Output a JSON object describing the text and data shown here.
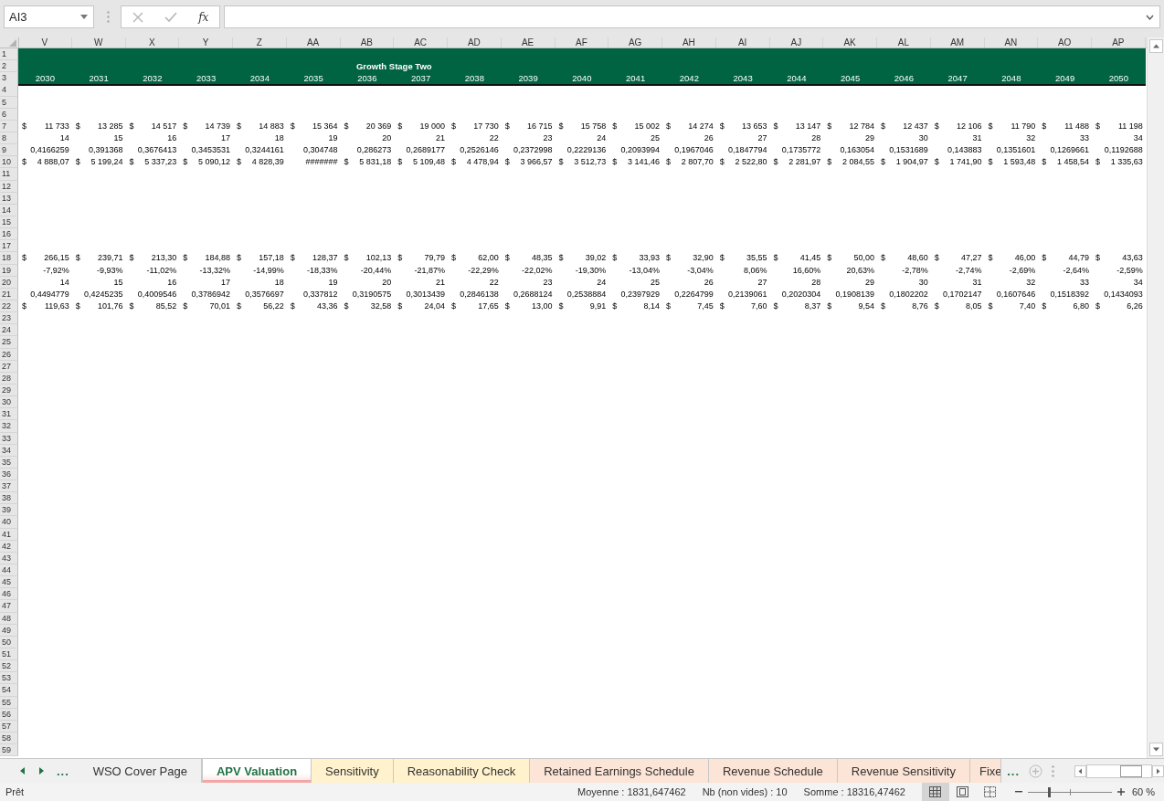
{
  "formula_bar": {
    "name_box": "AI3",
    "function_button": "fx"
  },
  "columns": [
    "V",
    "W",
    "X",
    "Y",
    "Z",
    "AA",
    "AB",
    "AC",
    "AD",
    "AE",
    "AF",
    "AG",
    "AH",
    "AI",
    "AJ",
    "AK",
    "AL",
    "AM",
    "AN",
    "AO",
    "AP"
  ],
  "rows": [
    {
      "number": "1",
      "kind": "banner"
    },
    {
      "number": "2",
      "kind": "banner",
      "title": "Growth Stage Two"
    },
    {
      "number": "3",
      "kind": "banner",
      "cells": [
        "2030",
        "2031",
        "2032",
        "2033",
        "2034",
        "2035",
        "2036",
        "2037",
        "2038",
        "2039",
        "2040",
        "2041",
        "2042",
        "2043",
        "2044",
        "2045",
        "2046",
        "2047",
        "2048",
        "2049",
        "2050"
      ]
    },
    {
      "number": "4"
    },
    {
      "number": "5"
    },
    {
      "number": "6"
    },
    {
      "number": "7",
      "cells": [
        [
          "$",
          "11 733"
        ],
        [
          "$",
          "13 285"
        ],
        [
          "$",
          "14 517"
        ],
        [
          "$",
          "14 739"
        ],
        [
          "$",
          "14 883"
        ],
        [
          "$",
          "15 364"
        ],
        [
          "$",
          "20 369"
        ],
        [
          "$",
          "19 000"
        ],
        [
          "$",
          "17 730"
        ],
        [
          "$",
          "16 715"
        ],
        [
          "$",
          "15 758"
        ],
        [
          "$",
          "15 002"
        ],
        [
          "$",
          "14 274"
        ],
        [
          "$",
          "13 653"
        ],
        [
          "$",
          "13 147"
        ],
        [
          "$",
          "12 784"
        ],
        [
          "$",
          "12 437"
        ],
        [
          "$",
          "12 106"
        ],
        [
          "$",
          "11 790"
        ],
        [
          "$",
          "11 488"
        ],
        [
          "$",
          "11 198"
        ]
      ]
    },
    {
      "number": "8",
      "cells": [
        "14",
        "15",
        "16",
        "17",
        "18",
        "19",
        "20",
        "21",
        "22",
        "23",
        "24",
        "25",
        "26",
        "27",
        "28",
        "29",
        "30",
        "31",
        "32",
        "33",
        "34"
      ]
    },
    {
      "number": "9",
      "cells": [
        "0,4166259",
        "0,391368",
        "0,3676413",
        "0,3453531",
        "0,3244161",
        "0,304748",
        "0,286273",
        "0,2689177",
        "0,2526146",
        "0,2372998",
        "0,2229136",
        "0,2093994",
        "0,1967046",
        "0,1847794",
        "0,1735772",
        "0,163054",
        "0,1531689",
        "0,143883",
        "0,1351601",
        "0,1269661",
        "0,1192688"
      ]
    },
    {
      "number": "10",
      "cells": [
        [
          "$",
          "4 888,07"
        ],
        [
          "$",
          "5 199,24"
        ],
        [
          "$",
          "5 337,23"
        ],
        [
          "$",
          "5 090,12"
        ],
        [
          "$",
          "4 828,39"
        ],
        "#######",
        [
          "$",
          "5 831,18"
        ],
        [
          "$",
          "5 109,48"
        ],
        [
          "$",
          "4 478,94"
        ],
        [
          "$",
          "3 966,57"
        ],
        [
          "$",
          "3 512,73"
        ],
        [
          "$",
          "3 141,46"
        ],
        [
          "$",
          "2 807,70"
        ],
        [
          "$",
          "2 522,80"
        ],
        [
          "$",
          "2 281,97"
        ],
        [
          "$",
          "2 084,55"
        ],
        [
          "$",
          "1 904,97"
        ],
        [
          "$",
          "1 741,90"
        ],
        [
          "$",
          "1 593,48"
        ],
        [
          "$",
          "1 458,54"
        ],
        [
          "$",
          "1 335,63"
        ]
      ]
    },
    {
      "number": "11"
    },
    {
      "number": "12"
    },
    {
      "number": "13"
    },
    {
      "number": "14"
    },
    {
      "number": "15"
    },
    {
      "number": "16"
    },
    {
      "number": "17"
    },
    {
      "number": "18",
      "cells": [
        [
          "$",
          "266,15"
        ],
        [
          "$",
          "239,71"
        ],
        [
          "$",
          "213,30"
        ],
        [
          "$",
          "184,88"
        ],
        [
          "$",
          "157,18"
        ],
        [
          "$",
          "128,37"
        ],
        [
          "$",
          "102,13"
        ],
        [
          "$",
          "79,79"
        ],
        [
          "$",
          "62,00"
        ],
        [
          "$",
          "48,35"
        ],
        [
          "$",
          "39,02"
        ],
        [
          "$",
          "33,93"
        ],
        [
          "$",
          "32,90"
        ],
        [
          "$",
          "35,55"
        ],
        [
          "$",
          "41,45"
        ],
        [
          "$",
          "50,00"
        ],
        [
          "$",
          "48,60"
        ],
        [
          "$",
          "47,27"
        ],
        [
          "$",
          "46,00"
        ],
        [
          "$",
          "44,79"
        ],
        [
          "$",
          "43,63"
        ]
      ]
    },
    {
      "number": "19",
      "cells": [
        "-7,92%",
        "-9,93%",
        "-11,02%",
        "-13,32%",
        "-14,99%",
        "-18,33%",
        "-20,44%",
        "-21,87%",
        "-22,29%",
        "-22,02%",
        "-19,30%",
        "-13,04%",
        "-3,04%",
        "8,06%",
        "16,60%",
        "20,63%",
        "-2,78%",
        "-2,74%",
        "-2,69%",
        "-2,64%",
        "-2,59%"
      ]
    },
    {
      "number": "20",
      "cells": [
        "14",
        "15",
        "16",
        "17",
        "18",
        "19",
        "20",
        "21",
        "22",
        "23",
        "24",
        "25",
        "26",
        "27",
        "28",
        "29",
        "30",
        "31",
        "32",
        "33",
        "34"
      ]
    },
    {
      "number": "21",
      "cells": [
        "0,4494779",
        "0,4245235",
        "0,4009546",
        "0,3786942",
        "0,3576697",
        "0,337812",
        "0,3190575",
        "0,3013439",
        "0,2846138",
        "0,2688124",
        "0,2538884",
        "0,2397929",
        "0,2264799",
        "0,2139061",
        "0,2020304",
        "0,1908139",
        "0,1802202",
        "0,1702147",
        "0,1607646",
        "0,1518392",
        "0,1434093"
      ]
    },
    {
      "number": "22",
      "cells": [
        [
          "$",
          "119,63"
        ],
        [
          "$",
          "101,76"
        ],
        [
          "$",
          "85,52"
        ],
        [
          "$",
          "70,01"
        ],
        [
          "$",
          "56,22"
        ],
        [
          "$",
          "43,36"
        ],
        [
          "$",
          "32,58"
        ],
        [
          "$",
          "24,04"
        ],
        [
          "$",
          "17,65"
        ],
        [
          "$",
          "13,00"
        ],
        [
          "$",
          "9,91"
        ],
        [
          "$",
          "8,14"
        ],
        [
          "$",
          "7,45"
        ],
        [
          "$",
          "7,60"
        ],
        [
          "$",
          "8,37"
        ],
        [
          "$",
          "9,54"
        ],
        [
          "$",
          "8,76"
        ],
        [
          "$",
          "8,05"
        ],
        [
          "$",
          "7,40"
        ],
        [
          "$",
          "6,80"
        ],
        [
          "$",
          "6,26"
        ]
      ]
    },
    {
      "number": "23"
    },
    {
      "number": "24"
    },
    {
      "number": "25"
    },
    {
      "number": "26"
    },
    {
      "number": "27"
    },
    {
      "number": "28"
    },
    {
      "number": "29"
    },
    {
      "number": "30"
    },
    {
      "number": "31"
    },
    {
      "number": "32"
    },
    {
      "number": "33"
    },
    {
      "number": "34"
    },
    {
      "number": "35"
    },
    {
      "number": "36"
    },
    {
      "number": "37"
    },
    {
      "number": "38"
    },
    {
      "number": "39"
    },
    {
      "number": "40"
    },
    {
      "number": "41"
    },
    {
      "number": "42"
    },
    {
      "number": "43"
    },
    {
      "number": "44"
    },
    {
      "number": "45"
    },
    {
      "number": "46"
    },
    {
      "number": "47"
    },
    {
      "number": "48"
    },
    {
      "number": "49"
    },
    {
      "number": "50"
    },
    {
      "number": "51"
    },
    {
      "number": "52"
    },
    {
      "number": "53"
    },
    {
      "number": "54"
    },
    {
      "number": "55"
    },
    {
      "number": "56"
    },
    {
      "number": "57"
    },
    {
      "number": "58"
    },
    {
      "number": "59"
    }
  ],
  "sheet_tabs": {
    "more_left": "...",
    "more_right": "...",
    "tabs": [
      {
        "label": "WSO Cover Page",
        "selected": false
      },
      {
        "label": "APV Valuation",
        "selected": true,
        "color": "#f4a6a6"
      },
      {
        "label": "Sensitivity",
        "selected": false,
        "color": "#fff2cc"
      },
      {
        "label": "Reasonability Check",
        "selected": false,
        "color": "#fff2cc"
      },
      {
        "label": "Retained Earnings Schedule",
        "selected": false,
        "color": "#fce4d6"
      },
      {
        "label": "Revenue Schedule",
        "selected": false,
        "color": "#fce4d6"
      },
      {
        "label": "Revenue Sensitivity",
        "selected": false,
        "color": "#fce4d6"
      },
      {
        "label": "Fixe",
        "selected": false,
        "color": "#fce4d6"
      }
    ]
  },
  "status_bar": {
    "status": "Prêt",
    "average": "Moyenne : 1831,647462",
    "count": "Nb (non vides) : 10",
    "sum": "Somme : 18316,47462",
    "views": [
      {
        "selected": true
      },
      {
        "selected": false
      },
      {
        "selected": false
      }
    ],
    "zoom": {
      "level": 0.24,
      "reading": "60 %"
    }
  }
}
